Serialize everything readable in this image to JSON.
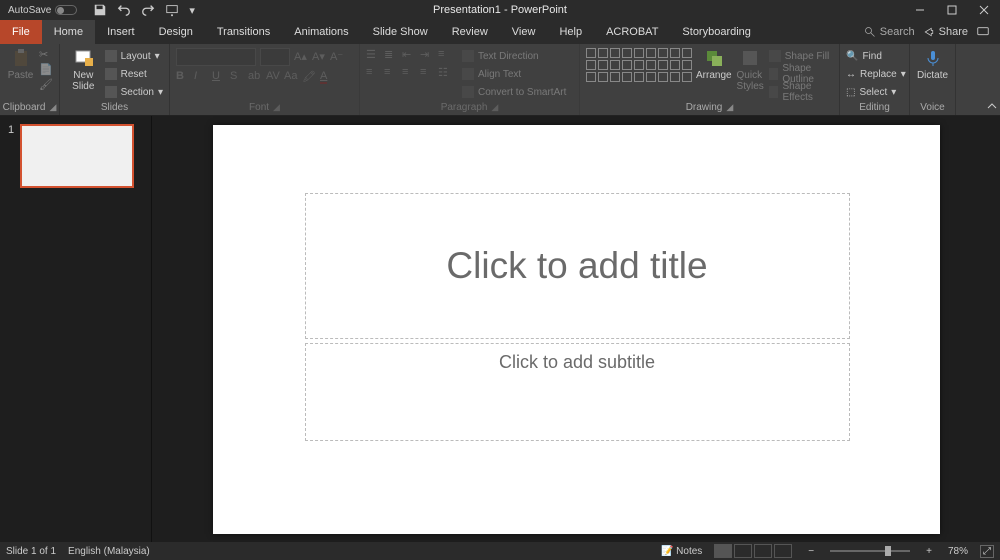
{
  "titlebar": {
    "autosave_label": "AutoSave",
    "title": "Presentation1 - PowerPoint"
  },
  "tabs": {
    "file": "File",
    "items": [
      "Home",
      "Insert",
      "Design",
      "Transitions",
      "Animations",
      "Slide Show",
      "Review",
      "View",
      "Help",
      "ACROBAT",
      "Storyboarding"
    ],
    "active": "Home",
    "search_placeholder": "Search",
    "share": "Share"
  },
  "ribbon": {
    "clipboard": {
      "label": "Clipboard",
      "paste": "Paste"
    },
    "slides": {
      "label": "Slides",
      "new_slide": "New\nSlide",
      "layout": "Layout",
      "reset": "Reset",
      "section": "Section"
    },
    "font": {
      "label": "Font"
    },
    "paragraph": {
      "label": "Paragraph",
      "textdir": "Text Direction",
      "align": "Align Text",
      "smartart": "Convert to SmartArt"
    },
    "drawing": {
      "label": "Drawing",
      "arrange": "Arrange",
      "quick": "Quick\nStyles",
      "fill": "Shape Fill",
      "outline": "Shape Outline",
      "effects": "Shape Effects"
    },
    "editing": {
      "label": "Editing",
      "find": "Find",
      "replace": "Replace",
      "select": "Select"
    },
    "voice": {
      "label": "Voice",
      "dictate": "Dictate"
    }
  },
  "slide": {
    "number": "1",
    "title_placeholder": "Click to add title",
    "subtitle_placeholder": "Click to add subtitle"
  },
  "status": {
    "slide_of": "Slide 1 of 1",
    "language": "English (Malaysia)",
    "notes": "Notes",
    "zoom": "78%"
  }
}
